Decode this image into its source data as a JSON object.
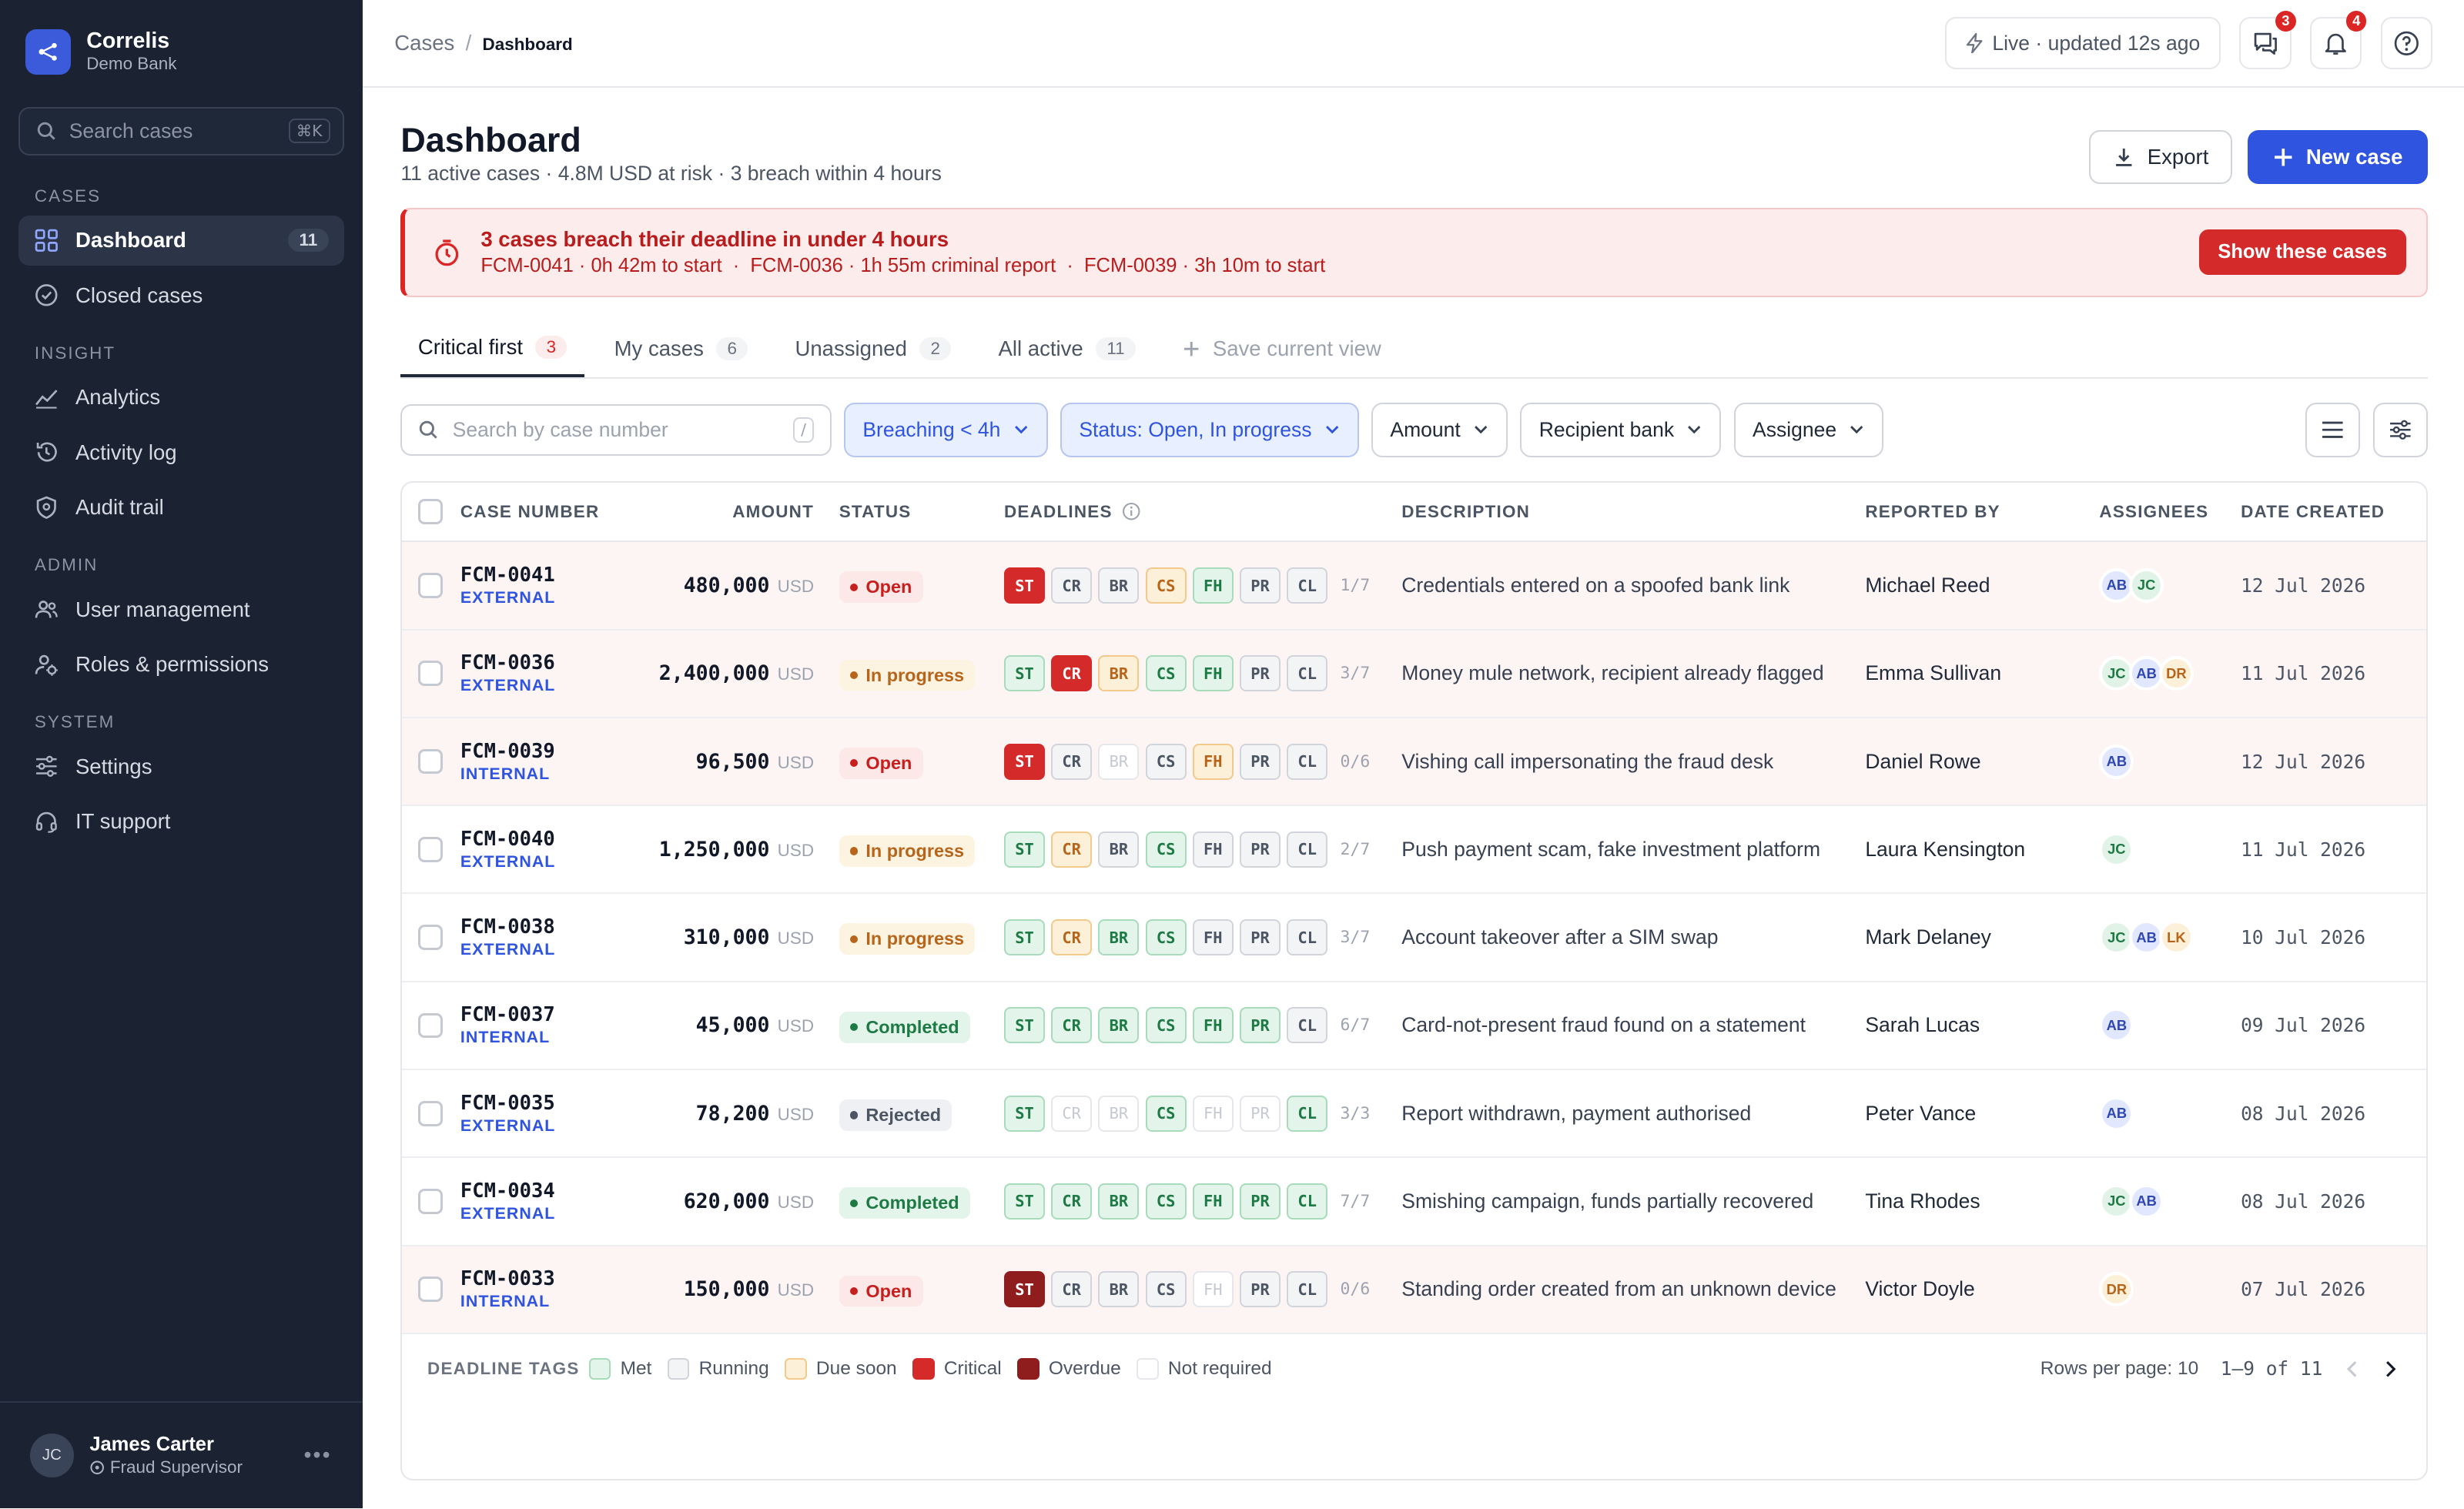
{
  "app": {
    "name": "Correlis",
    "org": "Demo Bank"
  },
  "sidebar": {
    "search_placeholder": "Search cases",
    "search_shortcut": "⌘K",
    "sections": [
      {
        "title": "CASES",
        "items": [
          {
            "label": "Dashboard",
            "icon": "grid-icon",
            "count": "11",
            "active": true
          },
          {
            "label": "Closed cases",
            "icon": "check-circle-icon"
          }
        ]
      },
      {
        "title": "INSIGHT",
        "items": [
          {
            "label": "Analytics",
            "icon": "trend-icon"
          },
          {
            "label": "Activity log",
            "icon": "history-icon"
          },
          {
            "label": "Audit trail",
            "icon": "shield-icon"
          }
        ]
      },
      {
        "title": "ADMIN",
        "items": [
          {
            "label": "User management",
            "icon": "users-icon"
          },
          {
            "label": "Roles & permissions",
            "icon": "user-key-icon"
          }
        ]
      },
      {
        "title": "SYSTEM",
        "items": [
          {
            "label": "Settings",
            "icon": "sliders-icon"
          },
          {
            "label": "IT support",
            "icon": "headset-icon"
          }
        ]
      }
    ],
    "user": {
      "initials": "JC",
      "name": "James Carter",
      "role": "Fraud Supervisor"
    }
  },
  "topbar": {
    "breadcrumb": [
      "Cases",
      "Dashboard"
    ],
    "live_status": "Live · updated 12s ago",
    "messages_count": "3",
    "notifications_count": "4"
  },
  "page": {
    "title": "Dashboard",
    "subtitle": "11 active cases · 4.8M USD at risk · 3 breach within 4 hours",
    "export_label": "Export",
    "new_case_label": "New case"
  },
  "alert": {
    "title": "3 cases breach their deadline in under 4 hours",
    "details": "FCM-0041 · 0h 42m to start  ·  FCM-0036 · 1h 55m criminal report  ·  FCM-0039 · 3h 10m to start",
    "button": "Show these cases"
  },
  "tabs": [
    {
      "label": "Critical first",
      "count": "3",
      "active": true
    },
    {
      "label": "My cases",
      "count": "6"
    },
    {
      "label": "Unassigned",
      "count": "2"
    },
    {
      "label": "All active",
      "count": "11"
    }
  ],
  "save_view_label": "Save current view",
  "filters": {
    "search_placeholder": "Search by case number",
    "search_shortcut": "/",
    "chips": [
      {
        "label": "Breaching < 4h",
        "active": true
      },
      {
        "label": "Status: Open, In progress",
        "active": true
      },
      {
        "label": "Amount",
        "active": false
      },
      {
        "label": "Recipient bank",
        "active": false
      },
      {
        "label": "Assignee",
        "active": false
      }
    ]
  },
  "table": {
    "columns": [
      "CASE NUMBER",
      "AMOUNT",
      "STATUS",
      "DEADLINES",
      "DESCRIPTION",
      "REPORTED BY",
      "ASSIGNEES",
      "DATE CREATED"
    ],
    "rows": [
      {
        "id": "FCM-0041",
        "type": "EXTERNAL",
        "amount": "480,000",
        "currency": "USD",
        "status": "Open",
        "deadlines": [
          "crit",
          "run",
          "run",
          "due",
          "met",
          "run",
          "run"
        ],
        "progress": "1/7",
        "description": "Credentials entered on a spoofed bank link",
        "reported_by": "Michael Reed",
        "assignees": [
          "AB",
          "JC"
        ],
        "date": "12 Jul 2026",
        "critical": true
      },
      {
        "id": "FCM-0036",
        "type": "EXTERNAL",
        "amount": "2,400,000",
        "currency": "USD",
        "status": "In progress",
        "deadlines": [
          "met",
          "crit",
          "due",
          "met",
          "met",
          "run",
          "run"
        ],
        "progress": "3/7",
        "description": "Money mule network, recipient already flagged",
        "reported_by": "Emma Sullivan",
        "assignees": [
          "JC",
          "AB",
          "DR"
        ],
        "date": "11 Jul 2026",
        "critical": true
      },
      {
        "id": "FCM-0039",
        "type": "INTERNAL",
        "amount": "96,500",
        "currency": "USD",
        "status": "Open",
        "deadlines": [
          "crit",
          "run",
          "nr",
          "run",
          "due",
          "run",
          "run"
        ],
        "progress": "0/6",
        "description": "Vishing call impersonating the fraud desk",
        "reported_by": "Daniel Rowe",
        "assignees": [
          "AB"
        ],
        "date": "12 Jul 2026",
        "critical": true
      },
      {
        "id": "FCM-0040",
        "type": "EXTERNAL",
        "amount": "1,250,000",
        "currency": "USD",
        "status": "In progress",
        "deadlines": [
          "met",
          "due",
          "run",
          "met",
          "run",
          "run",
          "run"
        ],
        "progress": "2/7",
        "description": "Push payment scam, fake investment platform",
        "reported_by": "Laura Kensington",
        "assignees": [
          "JC"
        ],
        "date": "11 Jul 2026",
        "critical": false
      },
      {
        "id": "FCM-0038",
        "type": "EXTERNAL",
        "amount": "310,000",
        "currency": "USD",
        "status": "In progress",
        "deadlines": [
          "met",
          "due",
          "met",
          "met",
          "run",
          "run",
          "run"
        ],
        "progress": "3/7",
        "description": "Account takeover after a SIM swap",
        "reported_by": "Mark Delaney",
        "assignees": [
          "JC",
          "AB",
          "LK"
        ],
        "date": "10 Jul 2026",
        "critical": false
      },
      {
        "id": "FCM-0037",
        "type": "INTERNAL",
        "amount": "45,000",
        "currency": "USD",
        "status": "Completed",
        "deadlines": [
          "met",
          "met",
          "met",
          "met",
          "met",
          "met",
          "run"
        ],
        "progress": "6/7",
        "description": "Card-not-present fraud found on a statement",
        "reported_by": "Sarah Lucas",
        "assignees": [
          "AB"
        ],
        "date": "09 Jul 2026",
        "critical": false
      },
      {
        "id": "FCM-0035",
        "type": "EXTERNAL",
        "amount": "78,200",
        "currency": "USD",
        "status": "Rejected",
        "deadlines": [
          "met",
          "nr",
          "nr",
          "met",
          "nr",
          "nr",
          "met"
        ],
        "progress": "3/3",
        "description": "Report withdrawn, payment authorised",
        "reported_by": "Peter Vance",
        "assignees": [
          "AB"
        ],
        "date": "08 Jul 2026",
        "critical": false
      },
      {
        "id": "FCM-0034",
        "type": "EXTERNAL",
        "amount": "620,000",
        "currency": "USD",
        "status": "Completed",
        "deadlines": [
          "met",
          "met",
          "met",
          "met",
          "met",
          "met",
          "met"
        ],
        "progress": "7/7",
        "description": "Smishing campaign, funds partially recovered",
        "reported_by": "Tina Rhodes",
        "assignees": [
          "JC",
          "AB"
        ],
        "date": "08 Jul 2026",
        "critical": false
      },
      {
        "id": "FCM-0033",
        "type": "INTERNAL",
        "amount": "150,000",
        "currency": "USD",
        "status": "Open",
        "deadlines": [
          "over",
          "run",
          "run",
          "run",
          "nr",
          "run",
          "run"
        ],
        "progress": "0/6",
        "description": "Standing order created from an unknown device",
        "reported_by": "Victor Doyle",
        "assignees": [
          "DR"
        ],
        "date": "07 Jul 2026",
        "critical": true
      }
    ],
    "deadline_codes": [
      "ST",
      "CR",
      "BR",
      "CS",
      "FH",
      "PR",
      "CL"
    ]
  },
  "legend": {
    "title": "DEADLINE TAGS",
    "items": [
      {
        "label": "Met",
        "kind": "met"
      },
      {
        "label": "Running",
        "kind": "run"
      },
      {
        "label": "Due soon",
        "kind": "due"
      },
      {
        "label": "Critical",
        "kind": "crit"
      },
      {
        "label": "Overdue",
        "kind": "over"
      },
      {
        "label": "Not required",
        "kind": "nr"
      }
    ]
  },
  "pagination": {
    "rows_per_page": "Rows per page: 10",
    "range": "1–9 of 11"
  }
}
